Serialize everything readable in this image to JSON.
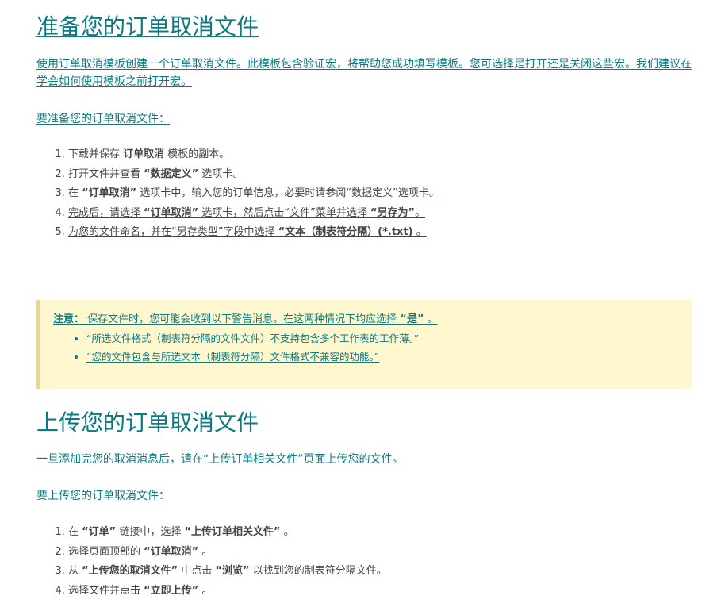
{
  "section1": {
    "title": "准备您的订单取消文件",
    "intro": "使用订单取消模板创建一个订单取消文件。此模板包含验证宏，将帮助您成功填写模板。您可选择是打开还是关闭这些宏。我们建议在学会如何使用模板之前打开宏。",
    "lead": "要准备您的订单取消文件：",
    "steps": [
      {
        "a": "下载并保存 ",
        "b": "订单取消",
        "c": " 模板的副本。"
      },
      {
        "a": "打开文件并查看 ",
        "b": "“数据定义”",
        "c": " 选项卡。"
      },
      {
        "a": "在 ",
        "b": "“订单取消”",
        "c": " 选项卡中，输入您的订单信息，必要时请参阅“数据定义”选项卡。"
      },
      {
        "a": "完成后，请选择 ",
        "b": "“订单取消”",
        "c": " 选项卡，然后点击“文件”菜单并选择 ",
        "d": "“另存为”",
        "e": "。"
      },
      {
        "a": "为您的文件命名，并在“另存类型”字段中选择 ",
        "b": "“文本（制表符分隔）(*.txt)",
        "c": " 。"
      }
    ]
  },
  "note": {
    "label": "注意：",
    "text_a": "保存文件时，您可能会收到以下警告消息。在这两种情况下均应选择 ",
    "text_b": "“是”",
    "text_c": " 。",
    "items": [
      "“所选文件格式（制表符分隔的文件文件）不支持包含多个工作表的工作薄。”",
      "“您的文件包含与所选文本（制表符分隔）文件格式不兼容的功能。”"
    ]
  },
  "section2": {
    "title": "上传您的订单取消文件",
    "intro": "一旦添加完您的取消消息后，请在“上传订单相关文件”页面上传您的文件。",
    "lead": "要上传您的订单取消文件：",
    "steps": [
      {
        "a": "在 ",
        "b": "“订单”",
        "c": " 链接中，选择 ",
        "d": "“上传订单相关文件”",
        "e": " 。"
      },
      {
        "a": "选择页面顶部的 ",
        "b": "“订单取消”",
        "c": " 。"
      },
      {
        "a": "从 ",
        "b": "“上传您的取消文件”",
        "c": " 中点击 ",
        "d": "“浏览”",
        "e": " 以找到您的制表符分隔文件。"
      },
      {
        "a": "选择文件并点击 ",
        "b": "“立即上传”",
        "c": " 。"
      }
    ]
  },
  "colors": {
    "accent": "#0b7a83",
    "note_bg": "#fff8cf",
    "note_border": "#e9d78e",
    "body_text": "#444444"
  }
}
